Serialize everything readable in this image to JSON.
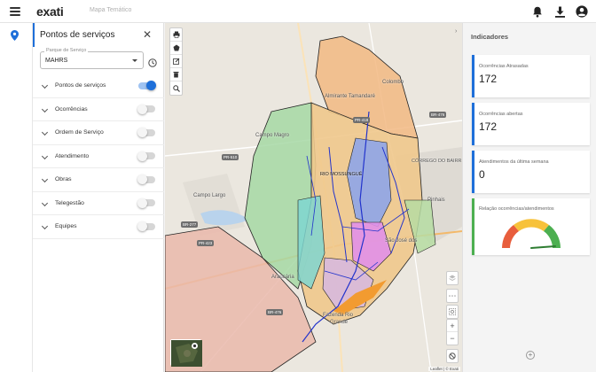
{
  "app": {
    "logo": "exati",
    "page_subtitle": "Mapa Temático",
    "accent_color": "#1e6fd9"
  },
  "topbar_icons": [
    "bell-icon",
    "download-icon",
    "account-icon"
  ],
  "panel": {
    "title": "Pontos de serviços",
    "service_park": {
      "legend": "Parque de Serviço",
      "value": "MAHRS"
    },
    "layers": [
      {
        "label": "Pontos de serviços",
        "enabled": true
      },
      {
        "label": "Ocorrências",
        "enabled": false
      },
      {
        "label": "Ordem de Serviço",
        "enabled": false
      },
      {
        "label": "Atendimento",
        "enabled": false
      },
      {
        "label": "Obras",
        "enabled": false
      },
      {
        "label": "Telegestão",
        "enabled": false
      },
      {
        "label": "Equipes",
        "enabled": false
      }
    ]
  },
  "map": {
    "labels": {
      "almirante": "Almirante Tamandaré",
      "colombo": "Colombo",
      "campo_magro": "Campo Magro",
      "corrego": "CÓRREGO DO BAIRR",
      "rio_mossungue": "RIO MOSSUNGUÊ",
      "campo_largo": "Campo Largo",
      "pinhais": "Pinhais",
      "sjp": "São José dos",
      "araucaria": "Araucária",
      "fazenda": "Fazenda Rio",
      "grande": "Grande"
    },
    "shields": {
      "br476_top": "BR-476",
      "pr418": "PR-418",
      "pr510": "PR-510",
      "br277": "BR-277",
      "pr423": "PR-423",
      "br476_bottom": "BR-476"
    },
    "attribution": "Leaflet | © Exati"
  },
  "indicators": {
    "title": "Indicadores",
    "cards": [
      {
        "label": "Ocorrências Atrasadas",
        "value": "172",
        "color": "#1e6fd9"
      },
      {
        "label": "Ocorrências abertas",
        "value": "172",
        "color": "#1e6fd9"
      },
      {
        "label": "Atendimentos da última semana",
        "value": "0",
        "color": "#1e6fd9"
      }
    ],
    "gauge": {
      "label": "Relação ocorrências/atendimentos",
      "color": "#4caf50",
      "segments": [
        "#e85e3d",
        "#f7c23b",
        "#4caf50"
      ]
    }
  }
}
